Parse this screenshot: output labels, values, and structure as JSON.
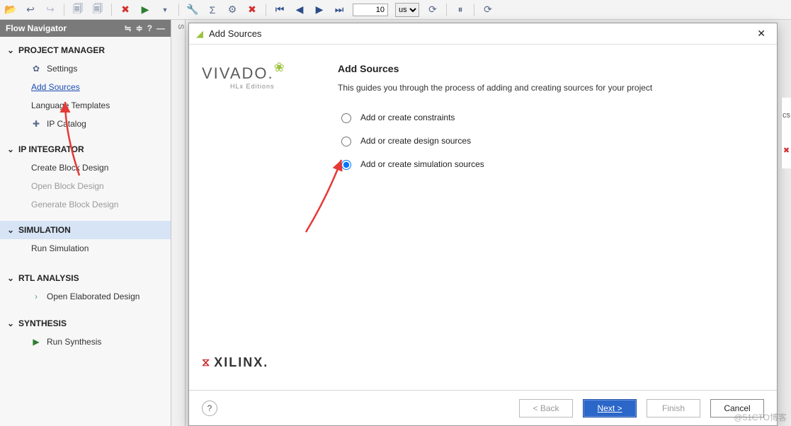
{
  "toolbar": {
    "time_value": "10",
    "time_unit": "us",
    "time_units": [
      "us"
    ]
  },
  "nav": {
    "title": "Flow Navigator",
    "sections": [
      {
        "label": "PROJECT MANAGER",
        "items": [
          {
            "label": "Settings",
            "icon": "⚙",
            "kind": "normal"
          },
          {
            "label": "Add Sources",
            "kind": "link"
          },
          {
            "label": "Language Templates",
            "kind": "normal"
          },
          {
            "label": "IP Catalog",
            "icon": "✚",
            "kind": "normal"
          }
        ]
      },
      {
        "label": "IP INTEGRATOR",
        "items": [
          {
            "label": "Create Block Design",
            "kind": "normal"
          },
          {
            "label": "Open Block Design",
            "kind": "dim"
          },
          {
            "label": "Generate Block Design",
            "kind": "dim"
          }
        ]
      },
      {
        "label": "SIMULATION",
        "selected": true,
        "items": [
          {
            "label": "Run Simulation",
            "kind": "normal"
          }
        ]
      },
      {
        "label": "RTL ANALYSIS",
        "items": [
          {
            "label": "Open Elaborated Design",
            "icon": "›",
            "kind": "normal"
          }
        ]
      },
      {
        "label": "SYNTHESIS",
        "items": [
          {
            "label": "Run Synthesis",
            "icon": "▶",
            "kind": "normal"
          }
        ]
      }
    ]
  },
  "dialog": {
    "title": "Add Sources",
    "heading": "Add Sources",
    "desc": "This guides you through the process of adding and creating sources for your project",
    "options": [
      {
        "label": "Add or create constraints",
        "value": "constraints"
      },
      {
        "label": "Add or create design sources",
        "value": "design"
      },
      {
        "label": "Add or create simulation sources",
        "value": "sim"
      }
    ],
    "selected": "sim",
    "brand_sub": "HLx Editions",
    "brand_main": "VIVADO.",
    "xilinx": "XILINX.",
    "buttons": {
      "back": "< Back",
      "next": "Next >",
      "finish": "Finish",
      "cancel": "Cancel"
    }
  },
  "watermark": "@51CTO博客"
}
